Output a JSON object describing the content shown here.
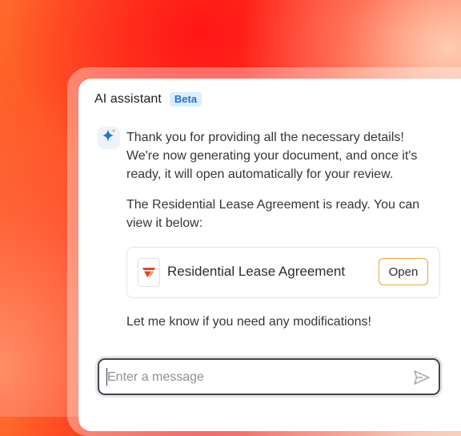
{
  "header": {
    "title": "AI assistant",
    "badge": "Beta"
  },
  "conversation": {
    "avatar_icon": "sparkle-icon",
    "message_intro": "Thank you for providing all the necessary details! We're now generating your document, and once it's ready, it will open automatically for your review.",
    "message_ready": "The Residential Lease Agreement is ready. You can view it below:",
    "document": {
      "icon": "document-logo-icon",
      "name": "Residential Lease Agreement",
      "open_label": "Open"
    },
    "message_followup": "Let me know if you need any modifications!"
  },
  "composer": {
    "placeholder": "Enter a message",
    "value": "",
    "send_icon": "send-icon"
  },
  "colors": {
    "accent_blue": "#1b74d8",
    "badge_bg": "#dbeeff",
    "open_border": "#f0a23a",
    "doc_logo": "#e8431f"
  }
}
